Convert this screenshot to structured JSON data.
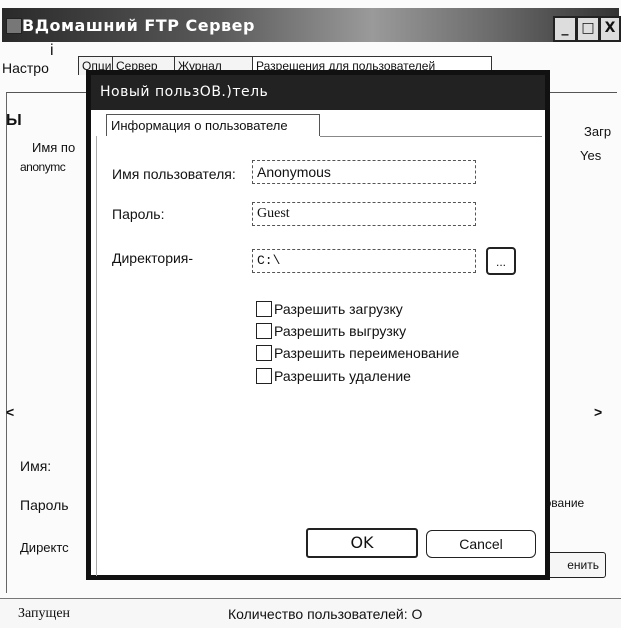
{
  "window": {
    "title": "Домашний FTP Сервер",
    "title_prefix": "В",
    "minimize": "_",
    "maximize": "□",
    "close": "X"
  },
  "outer_tabs": [
    "Опции",
    "Сервер",
    "Журнал",
    "Разрешения для пользователей"
  ],
  "outer_fragments": {
    "i_mark": "i",
    "settings": "Настро",
    "floppy": "Ы",
    "col_user": "Имя по",
    "row_user": "anonymc",
    "col_zagr": "Загр",
    "val_yes": "Yes",
    "scroll_left": "<",
    "scroll_right": ">",
    "label_name": "Имя:",
    "label_pass": "Пароль",
    "label_dir": "Директс",
    "label_rename": "нование",
    "btn_change": "енить"
  },
  "status": {
    "state": "Запущен",
    "user_count": "Количество пользователей: О"
  },
  "dialog": {
    "title": "Новый пользOB.)тель",
    "tab": "Информация о пользователе",
    "user_label": "Имя пользователя:",
    "user_value": "Anonymous",
    "pass_label": "Пароль:",
    "pass_value": "Guest",
    "dir_label": "Директория-",
    "dir_value": "C:\\",
    "browse": "...",
    "perms": [
      "Разрешить  загрузку",
      "Разрешить  выгрузку",
      "Разрешить  переименование",
      "Разрешить  удаление"
    ],
    "ok": "OK",
    "cancel": "Cancel"
  }
}
